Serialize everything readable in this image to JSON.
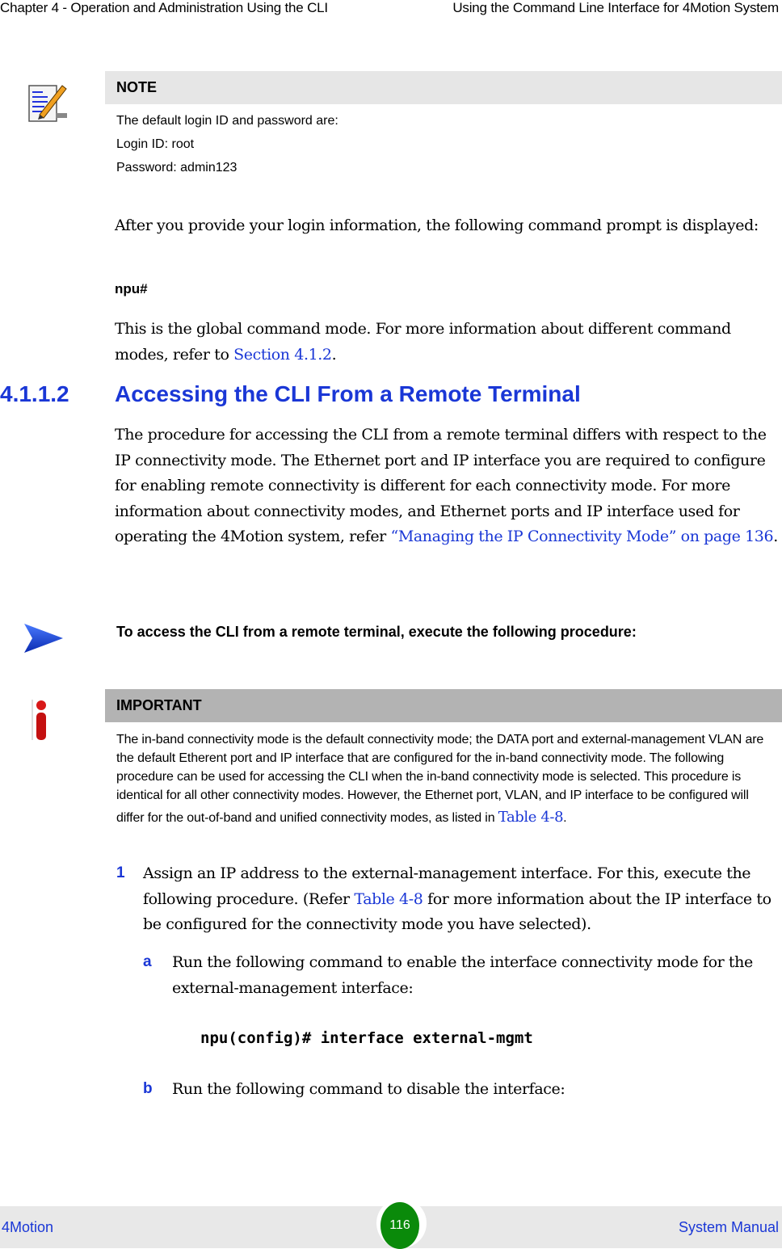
{
  "header": {
    "chapter": "Chapter 4 - Operation and Administration Using the CLI",
    "section_title": "Using the Command Line Interface for 4Motion System"
  },
  "note": {
    "icon": "note-pencil-icon",
    "title": "NOTE",
    "lines": [
      "The default login ID and password are:",
      "Login ID: root",
      "Password: admin123"
    ]
  },
  "body": {
    "para1": "After you provide your login information, the following command prompt is displayed:",
    "prompt": "npu#",
    "para2_prefix": "This is the global command mode. For more information about different command modes, refer to ",
    "para2_link": "Section 4.1.2",
    "para2_suffix": "."
  },
  "section": {
    "number": "4.1.1.2",
    "title": "Accessing the CLI From a Remote Terminal",
    "para_prefix": "The procedure for accessing the CLI from a remote terminal differs with respect to the IP connectivity mode. The Ethernet port and IP interface you are required to configure for enabling remote connectivity is different for each connectivity mode. For more information about connectivity modes, and Ethernet ports and IP interface used for operating the 4Motion system, refer ",
    "para_link": "“Managing the IP Connectivity Mode” on page 136",
    "para_suffix": "."
  },
  "procedure": {
    "icon": "arrow-right-icon",
    "heading": "To access the CLI from a remote terminal, execute the following procedure:"
  },
  "important": {
    "icon": "info-icon",
    "title": "IMPORTANT",
    "text_prefix": "The in-band connectivity mode is the default connectivity mode; the DATA port and external-management VLAN are the default Etherent port and IP interface that are configured for the in-band connectivity mode. The following procedure can be used for accessing the CLI when the in-band connectivity mode is selected. This procedure is identical for all other connectivity modes. However, the Ethernet port, VLAN, and IP interface to be configured will differ for the out-of-band and unified connectivity modes, as listed in ",
    "text_link": "Table 4-8",
    "text_suffix": "."
  },
  "steps": {
    "step1": {
      "label": "1",
      "prefix": "Assign an IP address to the external-management interface. For this, execute the following procedure. (Refer ",
      "link": "Table 4-8",
      "suffix": " for more information about the IP interface to be configured for the connectivity mode you have selected)."
    },
    "a": {
      "label": "a",
      "text": "Run the following command to enable the interface connectivity mode for the external-management interface:",
      "command": "npu(config)# interface external-mgmt"
    },
    "b": {
      "label": "b",
      "text": "Run the following command to disable the interface:"
    }
  },
  "footer": {
    "left": "4Motion",
    "page": "116",
    "right": "System Manual",
    "page_badge_color": "#0a8a0a"
  }
}
